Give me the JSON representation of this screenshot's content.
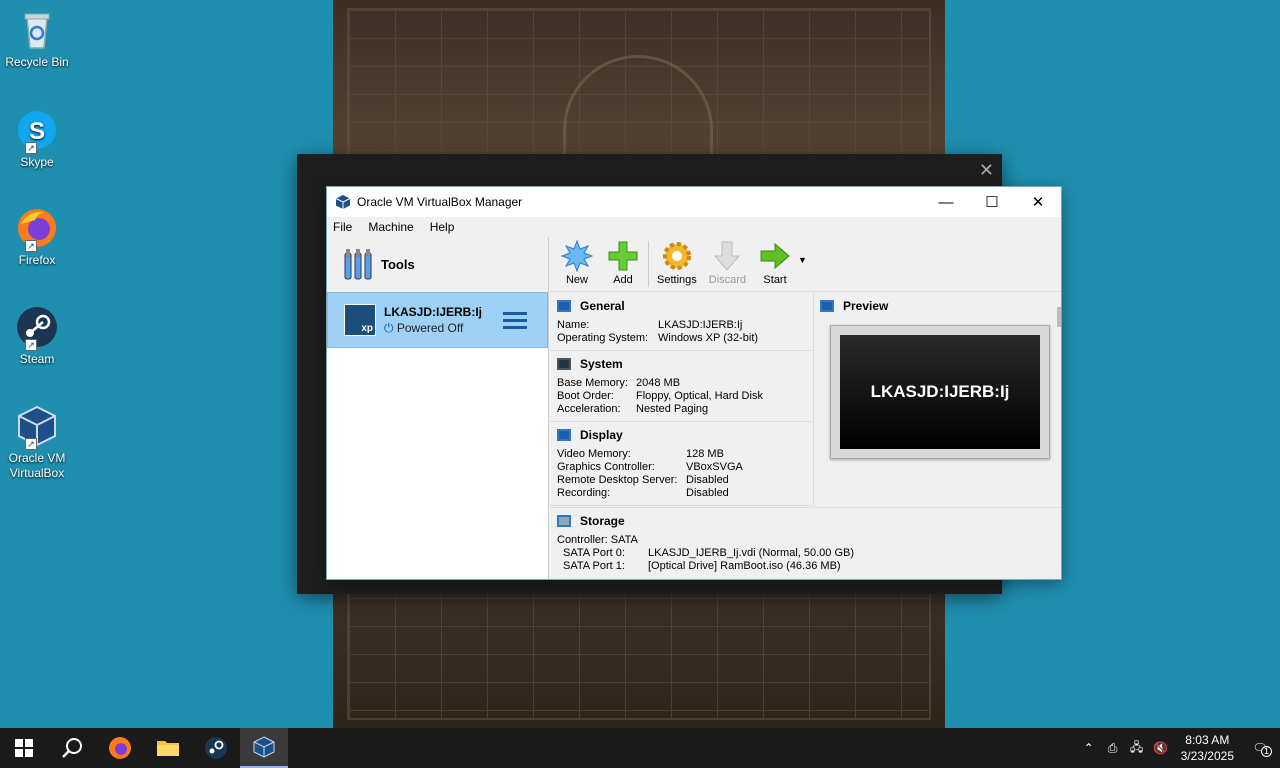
{
  "desktop": {
    "icons": [
      {
        "label": "Recycle Bin"
      },
      {
        "label": "Skype"
      },
      {
        "label": "Firefox"
      },
      {
        "label": "Steam"
      },
      {
        "label": "Oracle VM VirtualBox"
      }
    ]
  },
  "window": {
    "title": "Oracle VM VirtualBox Manager",
    "menu": [
      "File",
      "Machine",
      "Help"
    ]
  },
  "sidebar": {
    "tools_label": "Tools",
    "vm": {
      "name": "LKASJD:IJERB:Ij",
      "state": "Powered Off",
      "os_badge": "xp"
    }
  },
  "toolbar": {
    "new": "New",
    "add": "Add",
    "settings": "Settings",
    "discard": "Discard",
    "start": "Start"
  },
  "general": {
    "title": "General",
    "rows": [
      {
        "k": "Name:",
        "v": "LKASJD:IJERB:Ij"
      },
      {
        "k": "Operating System:",
        "v": "Windows XP (32-bit)"
      }
    ]
  },
  "system": {
    "title": "System",
    "rows": [
      {
        "k": "Base Memory:",
        "v": "2048 MB"
      },
      {
        "k": "Boot Order:",
        "v": "Floppy, Optical, Hard Disk"
      },
      {
        "k": "Acceleration:",
        "v": "Nested Paging"
      }
    ]
  },
  "display": {
    "title": "Display",
    "rows": [
      {
        "k": "Video Memory:",
        "v": "128 MB"
      },
      {
        "k": "Graphics Controller:",
        "v": "VBoxSVGA"
      },
      {
        "k": "Remote Desktop Server:",
        "v": "Disabled"
      },
      {
        "k": "Recording:",
        "v": "Disabled"
      }
    ]
  },
  "storage": {
    "title": "Storage",
    "controller": "Controller: SATA",
    "rows": [
      {
        "k": "SATA Port 0:",
        "v": "LKASJD_IJERB_Ij.vdi (Normal, 50.00 GB)"
      },
      {
        "k": "SATA Port 1:",
        "v": "[Optical Drive] RamBoot.iso (46.36 MB)"
      }
    ]
  },
  "preview": {
    "title": "Preview",
    "screen_text": "LKASJD:IJERB:Ij"
  },
  "taskbar": {
    "time": "8:03 AM",
    "date": "3/23/2025",
    "notification_count": "1"
  }
}
